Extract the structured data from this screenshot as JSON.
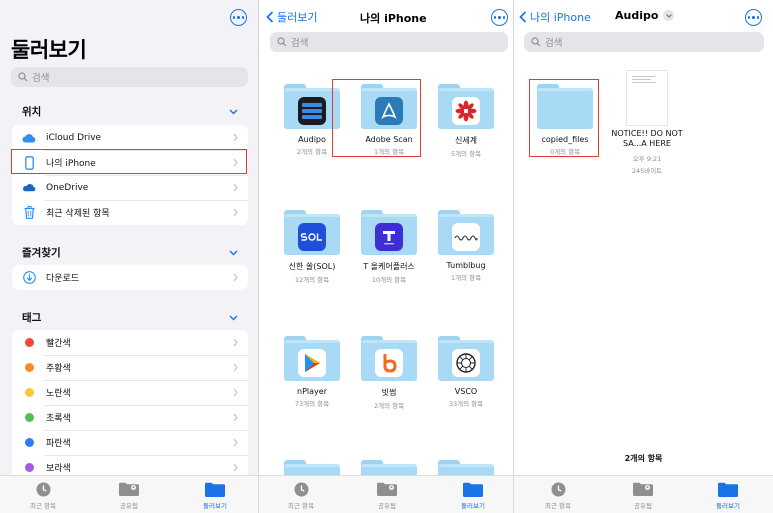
{
  "pane1": {
    "title": "둘러보기",
    "search_placeholder": "검색",
    "sections": {
      "locations": {
        "header": "위치",
        "items": [
          {
            "label": "iCloud Drive",
            "icon": "cloud-icon"
          },
          {
            "label": "나의 iPhone",
            "icon": "iphone-icon"
          },
          {
            "label": "OneDrive",
            "icon": "onedrive-icon"
          },
          {
            "label": "최근 삭제된 항목",
            "icon": "trash-icon"
          }
        ]
      },
      "favorites": {
        "header": "즐겨찾기",
        "items": [
          {
            "label": "다운로드",
            "icon": "download-icon"
          }
        ]
      },
      "tags": {
        "header": "태그",
        "items": [
          {
            "label": "빨간색",
            "color": "#f0483e"
          },
          {
            "label": "주황색",
            "color": "#f58a2b"
          },
          {
            "label": "노란색",
            "color": "#f5c83b"
          },
          {
            "label": "초록색",
            "color": "#4cc25a"
          },
          {
            "label": "파란색",
            "color": "#2f7df6"
          },
          {
            "label": "보라색",
            "color": "#a35be3"
          }
        ]
      }
    }
  },
  "pane2": {
    "back_label": "둘러보기",
    "title": "나의 iPhone",
    "search_placeholder": "검색",
    "folders": [
      {
        "name": "Audipo",
        "count": "2개의 항목"
      },
      {
        "name": "Adobe Scan",
        "count": "1개의 항목"
      },
      {
        "name": "신세계",
        "count": "5개의 항목"
      },
      {
        "name": "신한 쏠(SOL)",
        "count": "12개의 항목"
      },
      {
        "name": "T 올케어플러스",
        "count": "10개의 항목"
      },
      {
        "name": "Tumblbug",
        "count": "1개의 항목"
      },
      {
        "name": "nPlayer",
        "count": "73개의 항목"
      },
      {
        "name": "빗썸",
        "count": "2개의 항목"
      },
      {
        "name": "VSCO",
        "count": "33개의 항목"
      }
    ]
  },
  "pane3": {
    "back_label": "나의 iPhone",
    "title": "Audipo",
    "search_placeholder": "검색",
    "items": [
      {
        "name": "copied_files",
        "meta1": "0개의 항목"
      },
      {
        "name": "NOTICE!! DO NOT SA...A HERE",
        "meta1": "오후 9:21",
        "meta2": "245바이트"
      }
    ],
    "item_count": "2개의 항목"
  },
  "tabbar": {
    "recent": "최근 항목",
    "shared": "공유됨",
    "browse": "둘러보기"
  },
  "colors": {
    "accent": "#1a73e8",
    "highlight": "#e03a3a",
    "folder": "#a9daf5"
  }
}
